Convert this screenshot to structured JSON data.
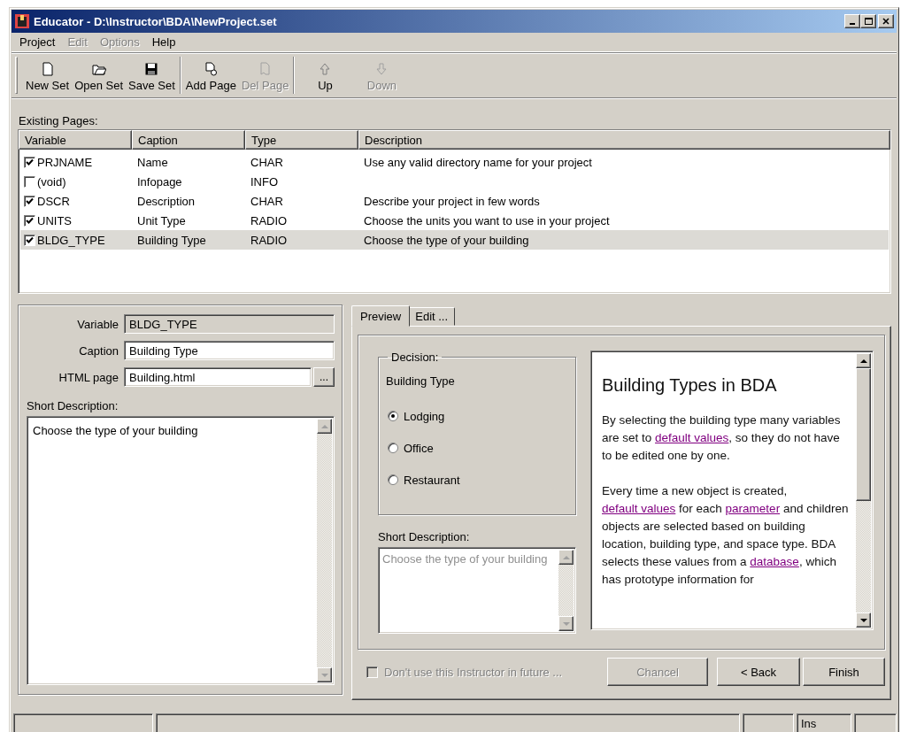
{
  "window": {
    "title": "Educator - D:\\Instructor\\BDA\\NewProject.set"
  },
  "menu": [
    {
      "label": "Project",
      "disabled": false
    },
    {
      "label": "Edit",
      "disabled": true
    },
    {
      "label": "Options",
      "disabled": true
    },
    {
      "label": "Help",
      "disabled": false
    }
  ],
  "toolbar": [
    {
      "kind": "button",
      "label": "New Set",
      "disabled": false
    },
    {
      "kind": "button",
      "label": "Open Set",
      "disabled": false
    },
    {
      "kind": "button",
      "label": "Save Set",
      "disabled": false
    },
    {
      "kind": "separator"
    },
    {
      "kind": "button",
      "label": "Add Page",
      "disabled": false
    },
    {
      "kind": "button",
      "label": "Del Page",
      "disabled": true
    },
    {
      "kind": "separator"
    },
    {
      "kind": "button",
      "label": "Up",
      "disabled": false
    },
    {
      "kind": "button",
      "label": "Down",
      "disabled": true
    }
  ],
  "existing_pages": {
    "label": "Existing Pages:",
    "columns": [
      "Variable",
      "Caption",
      "Type",
      "Description"
    ],
    "rows": [
      {
        "variable": "PRJNAME",
        "caption": "Name",
        "type": "CHAR",
        "description": "Use any valid directory name for your project",
        "checked": true,
        "selected": false
      },
      {
        "variable": "(void)",
        "caption": "Infopage",
        "type": "INFO",
        "checked": false,
        "selected": false
      },
      {
        "variable": "DSCR",
        "caption": "Description",
        "type": "CHAR",
        "description": "Describe your project in few words",
        "checked": true,
        "selected": false
      },
      {
        "variable": "UNITS",
        "caption": "Unit Type",
        "type": "RADIO",
        "description": "Choose the units you want to use in your project",
        "checked": true,
        "selected": false
      },
      {
        "variable": "BLDG_TYPE",
        "caption": "Building Type",
        "type": "RADIO",
        "description": "Choose the type of your building",
        "checked": true,
        "selected": true
      }
    ]
  },
  "properties": {
    "fields": [
      {
        "label": "Variable",
        "value": "BLDG_TYPE",
        "disabled": true
      },
      {
        "label": "Caption",
        "value": "Building Type",
        "disabled": false
      },
      {
        "label": "HTML page",
        "value": "Building.html",
        "disabled": false,
        "browse": "..."
      }
    ],
    "short_description": {
      "label": "Short Description:",
      "value": "Choose the type of your building"
    }
  },
  "tabs": [
    {
      "label": "Preview",
      "selected": true
    },
    {
      "label": "Edit ...",
      "selected": false
    }
  ],
  "preview": {
    "decision": {
      "legend": "Decision:",
      "question": "Building Type",
      "options": [
        {
          "label": "Lodging",
          "selected": true
        },
        {
          "label": "Office",
          "selected": false
        },
        {
          "label": "Restaurant",
          "selected": false
        }
      ]
    },
    "short_description": {
      "label": "Short Description:",
      "value": "Choose the type of your building",
      "disabled": true
    },
    "html": {
      "heading": "Building Types in BDA",
      "paragraphs": [
        [
          {
            "text": "By selecting the building type many variables are set to "
          },
          {
            "text": "default values",
            "link": true
          },
          {
            "text": ", so they do not have to be edited one by one."
          }
        ],
        [
          {
            "text": "Every time a new object is created, "
          },
          {
            "text": "default values",
            "link": true
          },
          {
            "text": " for each "
          },
          {
            "text": "parameter",
            "link": true
          },
          {
            "text": " and children objects are selected based on building location, building type, and space type. BDA selects these values from a "
          },
          {
            "text": "database",
            "link": true
          },
          {
            "text": ", which has prototype information for"
          }
        ]
      ]
    }
  },
  "dont_use": {
    "label": "Don't use this Instructor in future ...",
    "checked": false,
    "disabled": true
  },
  "buttons": [
    {
      "label": "Chancel",
      "disabled": true
    },
    {
      "label": "< Back",
      "disabled": false
    },
    {
      "label": "Finish",
      "disabled": false
    }
  ],
  "status_bar": {
    "mode": "Ins"
  }
}
